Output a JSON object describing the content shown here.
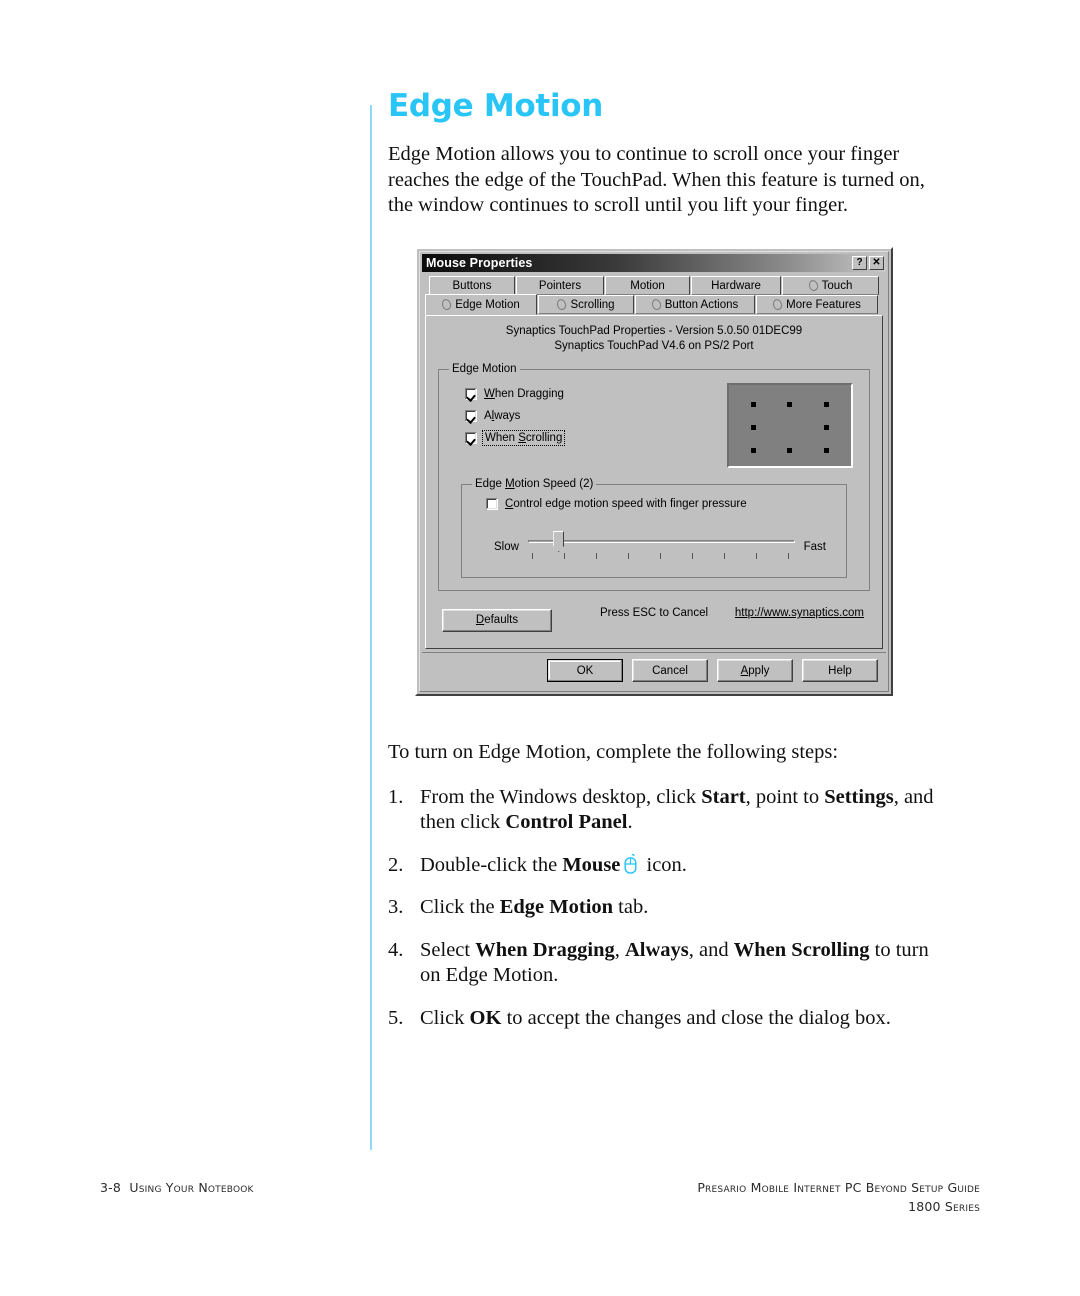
{
  "page": {
    "title": "Edge Motion",
    "intro": "Edge Motion allows you to continue to scroll once your finger reaches the edge of the TouchPad. When this feature is turned on, the window continues to scroll until you lift your finger.",
    "accent_color": "#29c5f6",
    "rule_color": "#8fd9f5"
  },
  "dialog": {
    "title": "Mouse Properties",
    "titlebar_buttons": [
      {
        "name": "help-button",
        "glyph": "?"
      },
      {
        "name": "close-button",
        "glyph": "✕"
      }
    ],
    "tabs_row1": [
      {
        "label": "Buttons",
        "icon": false,
        "selected": false
      },
      {
        "label": "Pointers",
        "icon": false,
        "selected": false
      },
      {
        "label": "Motion",
        "icon": false,
        "selected": false
      },
      {
        "label": "Hardware",
        "icon": false,
        "selected": false
      },
      {
        "label": "Touch",
        "icon": true,
        "selected": false
      }
    ],
    "tabs_row2": [
      {
        "label": "Edge Motion",
        "icon": true,
        "selected": true
      },
      {
        "label": "Scrolling",
        "icon": true,
        "selected": false
      },
      {
        "label": "Button Actions",
        "icon": true,
        "selected": false
      },
      {
        "label": "More Features",
        "icon": true,
        "selected": false
      }
    ],
    "version_line1": "Synaptics TouchPad Properties - Version 5.0.50 01DEC99",
    "version_line2": "Synaptics TouchPad V4.6 on PS/2 Port",
    "group_edge_motion": {
      "legend": "Edge Motion",
      "checkboxes": [
        {
          "label": "When Dragging",
          "accel": "W",
          "checked": true,
          "focused": false
        },
        {
          "label": "Always",
          "accel": "l",
          "checked": true,
          "focused": false
        },
        {
          "label": "When Scrolling",
          "accel": "S",
          "checked": true,
          "focused": true
        }
      ],
      "preview": {
        "name": "touchpad-preview",
        "dot_count": 8,
        "grid": "3x3-minus-center"
      }
    },
    "group_speed": {
      "legend": "Edge Motion Speed (2)",
      "checkbox": {
        "label": "Control edge motion speed with finger pressure",
        "accel": "C",
        "checked": false
      },
      "slider": {
        "min_label": "Slow",
        "max_label": "Fast",
        "tick_count": 9,
        "value": 2,
        "min": 1,
        "max": 9
      }
    },
    "footer_area": {
      "defaults_button": "Defaults",
      "esc_text": "Press ESC to Cancel",
      "url": "http://www.synaptics.com"
    },
    "action_buttons": [
      {
        "label": "OK",
        "default": true
      },
      {
        "label": "Cancel",
        "default": false
      },
      {
        "label": "Apply",
        "default": false
      },
      {
        "label": "Help",
        "default": false
      }
    ]
  },
  "steps_section": {
    "lead": "To turn on Edge Motion, complete the following steps:",
    "items": [
      {
        "num": "1."
      },
      {
        "num": "2."
      },
      {
        "num": "3."
      },
      {
        "num": "4."
      },
      {
        "num": "5."
      }
    ],
    "step1": {
      "a": "From the Windows desktop, click ",
      "b1": "Start",
      "c": ", point to ",
      "b2": "Settings",
      "d": ", and then click ",
      "b3": "Control Panel",
      "e": "."
    },
    "step2": {
      "a": "Double-click the ",
      "b1": "Mouse",
      "c": " icon."
    },
    "step3": {
      "a": "Click the ",
      "b1": "Edge Motion",
      "c": " tab."
    },
    "step4": {
      "a": "Select ",
      "b1": "When Dragging",
      "c": ", ",
      "b2": "Always",
      "d": ", and ",
      "b3": "When Scrolling",
      "e": " to turn on Edge Motion."
    },
    "step5": {
      "a": "Click ",
      "b1": "OK",
      "c": " to accept the changes and close the dialog box."
    }
  },
  "footer": {
    "page_number": "3-8",
    "section": "Using Your Notebook",
    "guide": "Presario Mobile Internet PC Beyond Setup Guide",
    "series": "1800 Series"
  }
}
